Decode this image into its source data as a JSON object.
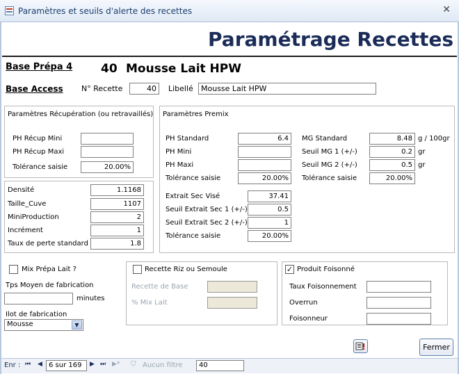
{
  "window": {
    "title": "Paramètres et seuils d'alerte des recettes",
    "close": "✕"
  },
  "header": {
    "title": "Paramétrage Recettes"
  },
  "recipe": {
    "base_prepa_label": "Base Prépa 4",
    "number_big": "40",
    "name_big": "Mousse Lait HPW",
    "base_access_label": "Base Access",
    "num_label": "N° Recette",
    "num_value": "40",
    "libelle_label": "Libellé",
    "libelle_value": "Mousse Lait HPW"
  },
  "recup": {
    "title": "Paramètres Récupération (ou retravaillés)",
    "ph_min_label": "PH Récup Mini",
    "ph_min_value": "",
    "ph_max_label": "PH Récup Maxi",
    "ph_max_value": "",
    "tol_label": "Tolérance saisie",
    "tol_value": "20.00%"
  },
  "general": {
    "densite_label": "Densité",
    "densite_value": "1.1168",
    "cuve_label": "Taille_Cuve",
    "cuve_value": "1107",
    "miniprod_label": "MiniProduction",
    "miniprod_value": "2",
    "increment_label": "Incrément",
    "increment_value": "1",
    "perte_label": "Taux de perte standard",
    "perte_value": "1.8"
  },
  "premix": {
    "title": "Paramètres Premix",
    "ph_std_label": "PH Standard",
    "ph_std_value": "6.4",
    "ph_min_label": "PH Mini",
    "ph_min_value": "",
    "ph_max_label": "PH Maxi",
    "ph_max_value": "",
    "tol1_label": "Tolérance saisie",
    "tol1_value": "20.00%",
    "extrait_label": "Extrait Sec Visé",
    "extrait_value": "37.41",
    "seuil_es1_label": "Seuil Extrait Sec 1 (+/-)",
    "seuil_es1_value": "0.5",
    "seuil_es2_label": "Seuil Extrait Sec 2 (+/-)",
    "seuil_es2_value": "1",
    "tol2_label": "Tolérance saisie",
    "tol2_value": "20.00%",
    "mg_std_label": "MG Standard",
    "mg_std_value": "8.48",
    "mg_std_unit": "g / 100gr",
    "seuil_mg1_label": "Seuil MG 1 (+/-)",
    "seuil_mg1_value": "0.2",
    "seuil_mg1_unit": "gr",
    "seuil_mg2_label": "Seuil MG 2 (+/-)",
    "seuil_mg2_value": "0.5",
    "seuil_mg2_unit": "gr",
    "tol3_label": "Tolérance saisie",
    "tol3_value": "20.00%"
  },
  "prepa": {
    "mix_label": "Mix Prépa Lait ?",
    "mix_checked": false,
    "tps_label": "Tps Moyen de fabrication",
    "tps_value": "",
    "tps_unit": "minutes",
    "ilot_label": "Ilot de fabrication",
    "ilot_value": "Mousse"
  },
  "riz": {
    "label": "Recette Riz ou Semoule",
    "checked": false,
    "base_label": "Recette de Base",
    "base_value": "",
    "mix_label": "% Mix Lait",
    "mix_value": ""
  },
  "foison": {
    "label": "Produit Foisonné",
    "checked": true,
    "taux_label": "Taux Foisonnement",
    "taux_value": "",
    "overrun_label": "Overrun",
    "overrun_value": "",
    "foisonneur_label": "Foisonneur",
    "foisonneur_value": ""
  },
  "buttons": {
    "fermer": "Fermer"
  },
  "nav": {
    "enr_label": "Enr :",
    "first": "⏮",
    "prev": "◀",
    "position": "6 sur 169",
    "next": "▶",
    "last": "⏭",
    "new": "▶*",
    "filter_label": "Aucun filtre",
    "search_value": "40"
  }
}
